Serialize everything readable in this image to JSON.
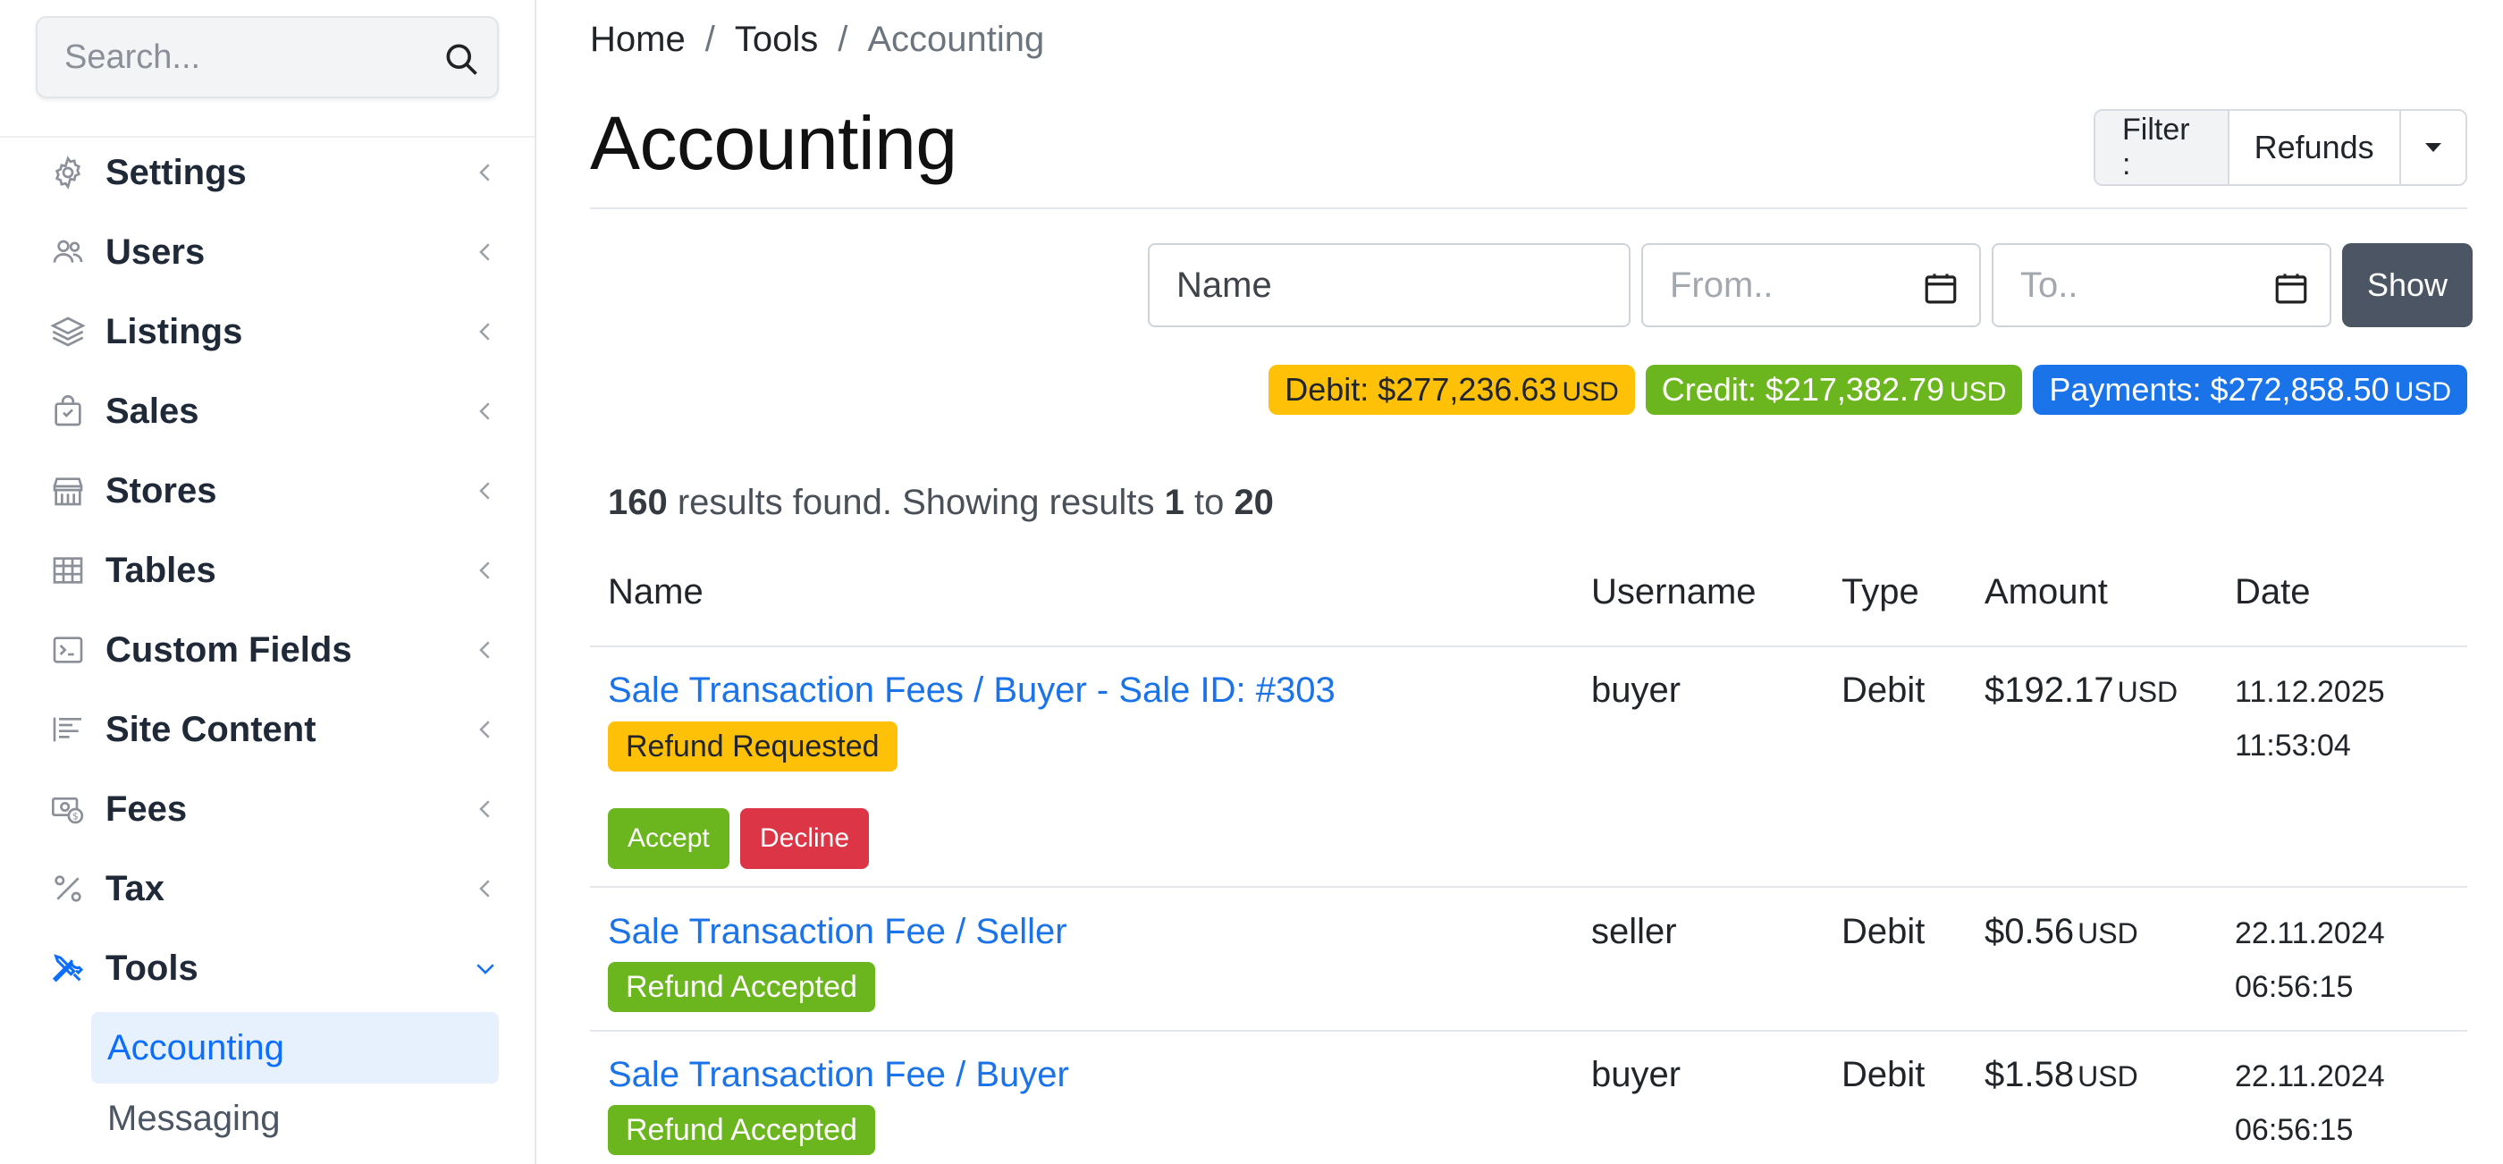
{
  "sidebar": {
    "search": {
      "placeholder": "Search..."
    },
    "items": [
      {
        "label": "Settings",
        "icon": "gear-icon"
      },
      {
        "label": "Users",
        "icon": "users-icon"
      },
      {
        "label": "Listings",
        "icon": "layers-icon"
      },
      {
        "label": "Sales",
        "icon": "shopping-bag-icon"
      },
      {
        "label": "Stores",
        "icon": "store-icon"
      },
      {
        "label": "Tables",
        "icon": "table-icon"
      },
      {
        "label": "Custom Fields",
        "icon": "terminal-icon"
      },
      {
        "label": "Site Content",
        "icon": "text-align-icon"
      },
      {
        "label": "Fees",
        "icon": "money-icon"
      },
      {
        "label": "Tax",
        "icon": "percent-icon"
      },
      {
        "label": "Tools",
        "icon": "tools-icon"
      }
    ],
    "sub_items": [
      {
        "label": "Accounting"
      },
      {
        "label": "Messaging"
      }
    ],
    "accent": "#0d6efd"
  },
  "breadcrumb": [
    "Home",
    "Tools",
    "Accounting"
  ],
  "breadcrumb_sep": "/",
  "page_title": "Accounting",
  "filter": {
    "label": "Filter :",
    "value": "Refunds"
  },
  "form": {
    "name_placeholder": "Name",
    "from_placeholder": "From..",
    "to_placeholder": "To..",
    "show_label": "Show"
  },
  "summary": {
    "debit": {
      "label": "Debit: $277,236.63",
      "currency": "USD",
      "color": "#ffc107"
    },
    "credit": {
      "label": "Credit: $217,382.79",
      "currency": "USD",
      "color": "#6bb61e"
    },
    "payments": {
      "label": "Payments: $272,858.50",
      "currency": "USD",
      "color": "#1a73e8"
    }
  },
  "results": {
    "total": "160",
    "text1": " results found. Showing results ",
    "from": "1",
    "text2": " to ",
    "to": "20"
  },
  "table": {
    "headers": [
      "Name",
      "Username",
      "Type",
      "Amount",
      "Date"
    ],
    "rows": [
      {
        "name": "Sale Transaction Fees / Buyer - Sale ID: #303",
        "status": "Refund Requested",
        "username": "buyer",
        "type": "Debit",
        "amount": "$192.17",
        "currency": "USD",
        "date": "11.12.2025",
        "time": "11:53:04",
        "actions": [
          "Accept",
          "Decline"
        ]
      },
      {
        "name": "Sale Transaction Fee / Seller",
        "status": "Refund Accepted",
        "username": "seller",
        "type": "Debit",
        "amount": "$0.56",
        "currency": "USD",
        "date": "22.11.2024",
        "time": "06:56:15"
      },
      {
        "name": "Sale Transaction Fee / Buyer",
        "status": "Refund Accepted",
        "username": "buyer",
        "type": "Debit",
        "amount": "$1.58",
        "currency": "USD",
        "date": "22.11.2024",
        "time": "06:56:15"
      }
    ]
  }
}
